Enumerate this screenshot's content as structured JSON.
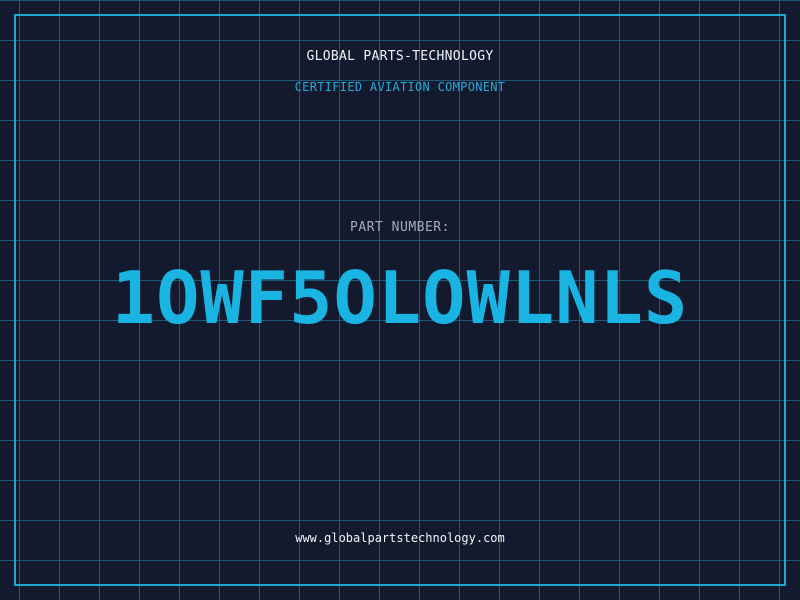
{
  "header": {
    "company": "GLOBAL PARTS-TECHNOLOGY",
    "subtitle": "CERTIFIED AVIATION COMPONENT"
  },
  "part": {
    "label": "PART NUMBER:",
    "number": "1OWF5OLOWLNLS"
  },
  "footer": {
    "website": "www.globalpartstechnology.com"
  },
  "colors": {
    "background": "#131a2e",
    "grid": "#1e6e8c",
    "accent": "#1ab4e3",
    "frame": "#1ea7cf"
  }
}
